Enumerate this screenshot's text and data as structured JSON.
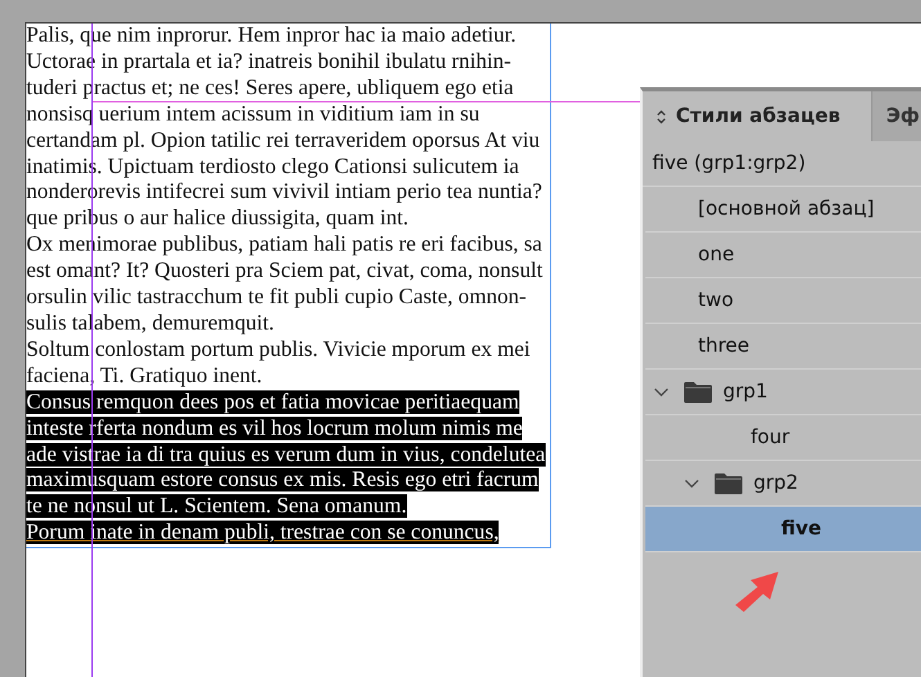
{
  "text_frame": {
    "lines": [
      {
        "text": "Palis, que nim inprorur. Hem inpror hac ia maio adetiur.",
        "selected": false
      },
      {
        "text": "Uctorae in prartala et ia? inatreis bonihil ibulatu rnihin-",
        "selected": false
      },
      {
        "text": "tuderi practus et; ne ces! Seres apere, ubliquem ego etia",
        "selected": false
      },
      {
        "text": "nonsisq uerium intem acissum in viditium iam in su",
        "selected": false
      },
      {
        "text": "certandam pl. Opion tatilic rei terraveridem oporsus At viu",
        "selected": false
      },
      {
        "text": "inatimis. Upictuam terdiosto clego Cationsi sulicutem ia",
        "selected": false
      },
      {
        "text": "nonderorevis intifecrei sum vivivil intiam perio tea nuntia?",
        "selected": false
      },
      {
        "text": "que pribus o aur halice diussigita, quam int.",
        "selected": false
      },
      {
        "text": "Ox menimorae publibus, patiam hali patis re eri facibus, sa",
        "selected": false
      },
      {
        "text": "est omant? It? Quosteri pra Sciem pat, civat, coma, nonsult",
        "selected": false
      },
      {
        "text": "orsulin vilic tastracchum te fit publi cupio Caste, omnon-",
        "selected": false
      },
      {
        "text": "sulis talabem, demuremquit.",
        "selected": false
      },
      {
        "text": "Soltum conlostam portum publis. Vivicie mporum ex mei",
        "selected": false
      },
      {
        "text": "faciena, Ti. Gratiquo inent.",
        "selected": false
      },
      {
        "text": "Consus remquon dees pos et fatia movicae peritiaequam",
        "selected": true
      },
      {
        "text": "inteste rferta nondum es vil hos locrum molum nimis me",
        "selected": true
      },
      {
        "text": "ade vistrae ia di tra quius es verum dum in vius, condelutea",
        "selected": true
      },
      {
        "text": "maximusquam estore consus ex mis. Resis ego etri facrum",
        "selected": true
      },
      {
        "text": "te ne nonsul ut L. Scientem. Sena omanum.",
        "selected": true
      },
      {
        "text": "Porum inate in denam publi, trestrae con se conuncus,",
        "selected": true,
        "underlined": true
      }
    ]
  },
  "panel": {
    "tabs": [
      {
        "label": "Стили абзацев",
        "selected": true
      },
      {
        "label": "Эф",
        "selected": false
      }
    ],
    "current_style": "five (grp1:grp2)",
    "styles": [
      {
        "kind": "style",
        "label": "[основной абзац]",
        "selected": false
      },
      {
        "kind": "style",
        "label": "one",
        "selected": false
      },
      {
        "kind": "style",
        "label": "two",
        "selected": false
      },
      {
        "kind": "style",
        "label": "three",
        "selected": false
      },
      {
        "kind": "group",
        "label": "grp1",
        "selected": false,
        "expanded": true,
        "children": [
          {
            "kind": "style",
            "label": "four",
            "selected": false
          },
          {
            "kind": "group",
            "label": "grp2",
            "selected": false,
            "expanded": true,
            "children": [
              {
                "kind": "style",
                "label": "five",
                "selected": true
              }
            ]
          }
        ]
      }
    ]
  }
}
